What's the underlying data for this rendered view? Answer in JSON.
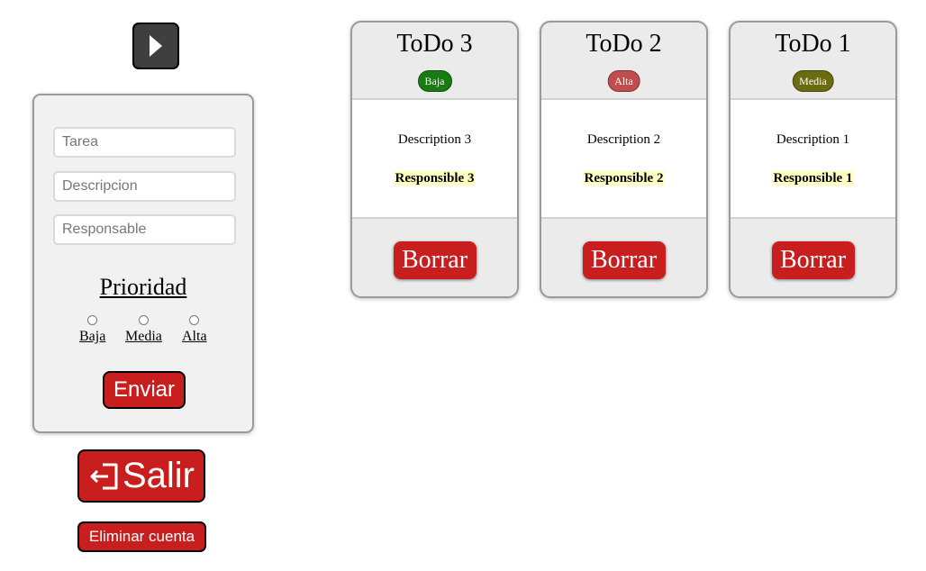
{
  "toolbar": {
    "play_icon": "play-icon"
  },
  "form": {
    "task_placeholder": "Tarea",
    "description_placeholder": "Descripcion",
    "responsible_placeholder": "Responsable",
    "priority_title": "Prioridad",
    "priority_options": [
      "Baja",
      "Media",
      "Alta"
    ],
    "submit_label": "Enviar"
  },
  "account": {
    "logout_label": "Salir",
    "logout_icon": "logout-icon",
    "delete_account_label": "Eliminar cuenta"
  },
  "todos": [
    {
      "title": "ToDo 3",
      "priority": "Baja",
      "priority_color": "#187a13",
      "description": "Description 3",
      "responsible": "Responsible 3",
      "delete_label": "Borrar"
    },
    {
      "title": "ToDo 2",
      "priority": "Alta",
      "priority_color": "#c14d4d",
      "description": "Description 2",
      "responsible": "Responsible 2",
      "delete_label": "Borrar"
    },
    {
      "title": "ToDo 1",
      "priority": "Media",
      "priority_color": "#6b6b10",
      "description": "Description 1",
      "responsible": "Responsible 1",
      "delete_label": "Borrar"
    }
  ],
  "colors": {
    "button_red": "#c91e1e",
    "highlight": "#ffffc2"
  }
}
